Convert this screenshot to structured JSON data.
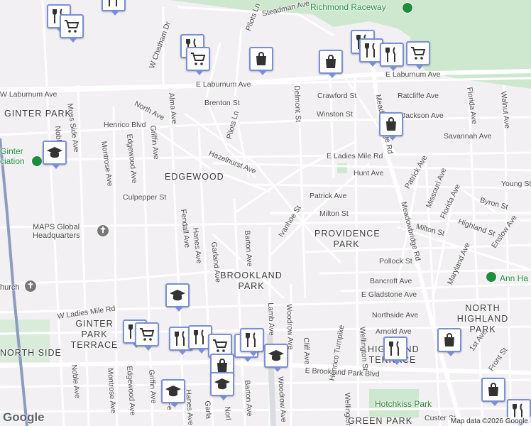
{
  "map": {
    "streets": [
      "Steadman Ave",
      "E Laburnum Ave",
      "W Laburnum Ave",
      "E Laburnum Ave",
      "Crawford St",
      "Ratcliffe Ave",
      "Brenton St",
      "Winston St",
      "Jackson Ave",
      "North Ave",
      "Henrico Blvd",
      "Savannah Ave",
      "Hazelhurst Ave",
      "E Ladies Mile Rd",
      "Hunt Ave",
      "Patrick Ave",
      "Culpepper St",
      "Young St",
      "Byron St",
      "Milton St",
      "Highland St",
      "Milton St",
      "Pollock St",
      "Enslow Ave",
      "Bancroft Ave",
      "E Gladstone Ave",
      "Northside Ave",
      "Arnold Ave",
      "W Ladies Mile Rd",
      "E Brookland Park Blvd",
      "Custer St",
      "Pilots Ln",
      "Pilots Ln",
      "W Chatham Dr",
      "Moss Side Ave",
      "Montrose Ave",
      "Edgewood Ave",
      "Griffin Ave",
      "Alma Ave",
      "Fendall Ave",
      "Hanes Ave",
      "Garland Ave",
      "Barton Ave",
      "Ivanhoe St",
      "Delmont St",
      "Meadowbridge Rd",
      "Meadowbridge Rd",
      "Florida Ave",
      "Walnut Ave",
      "Missouri Ave",
      "Florida Ave",
      "Maryland Ave",
      "Patrick Ave",
      "Lamb Ave",
      "Woodrow Ave",
      "Cliff Ave",
      "Wellington St",
      "Wellington St",
      "Noble Ave",
      "Montrose Ave",
      "Edgewood Ave",
      "Griffin Ave",
      "Hanes Ave",
      "Barton Ave",
      "Woodrow Ave",
      "Henrico Turnpike",
      "1st Ave",
      "Front St",
      "Nobl",
      "Garla",
      "Fe",
      "Norl"
    ],
    "areas": [
      "GINTER PARK",
      "EDGEWOOD",
      "PROVIDENCE PARK",
      "BROOKLAND PARK",
      "GINTER PARK TERRACE",
      "NORTH HIGHLAND PARK",
      "NORTH SIDE",
      "HIGHLAND TERRACE",
      "GREEN PARK"
    ],
    "pois": [
      "Richmond Raceway",
      "MAPS Global Headquarters",
      "Ann Ha",
      "Hotchkiss Park",
      "Ginter",
      "ciation",
      "hurch"
    ],
    "footer": {
      "logo": "Google",
      "copyright": "Map data ©2026 Google"
    },
    "colors": {
      "road": "#ffffff",
      "water": "#aadaff",
      "park": "#cde8cf",
      "highway": "#8c9bbf",
      "pin": "#7b8fd6",
      "bg": "#f2f0f2"
    }
  }
}
